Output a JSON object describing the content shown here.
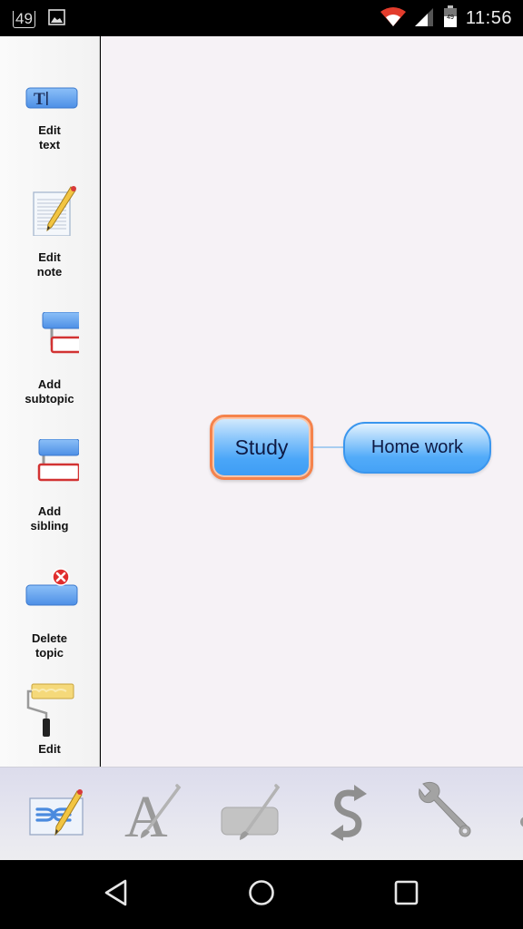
{
  "status_bar": {
    "notification_count": "49",
    "notification_icons": [
      "notification-count-icon",
      "image-icon"
    ],
    "system_icons": [
      "wifi-icon",
      "cell-signal-icon",
      "battery-icon"
    ],
    "battery_level": "49",
    "time": "11:56"
  },
  "sidebar": {
    "items": [
      {
        "icon": "edit-text-icon",
        "label": "Edit text"
      },
      {
        "icon": "edit-note-icon",
        "label": "Edit note"
      },
      {
        "icon": "add-subtopic-icon",
        "label": "Add subtopic"
      },
      {
        "icon": "add-sibling-icon",
        "label": "Add sibling"
      },
      {
        "icon": "delete-topic-icon",
        "label": "Delete topic"
      },
      {
        "icon": "paint-roller-icon",
        "label": "Edit"
      }
    ]
  },
  "mindmap": {
    "root_topic": "Study",
    "child_topics": [
      "Home work"
    ]
  },
  "toolbar": {
    "tools": [
      {
        "icon": "edit-map-icon",
        "name": "Edit map"
      },
      {
        "icon": "font-style-icon",
        "name": "Font style"
      },
      {
        "icon": "topic-style-icon",
        "name": "Topic style"
      },
      {
        "icon": "connection-style-icon",
        "name": "Relationships"
      },
      {
        "icon": "wrench-icon",
        "name": "Settings"
      }
    ]
  },
  "navbar": {
    "buttons": [
      "back",
      "home",
      "recents"
    ]
  },
  "colors": {
    "root_border": "#f5834c",
    "topic_fill": "#4aa6f8",
    "topic_text": "#0e1a44",
    "canvas_bg": "#f6f2f6",
    "connector": "#a8cdf0"
  }
}
